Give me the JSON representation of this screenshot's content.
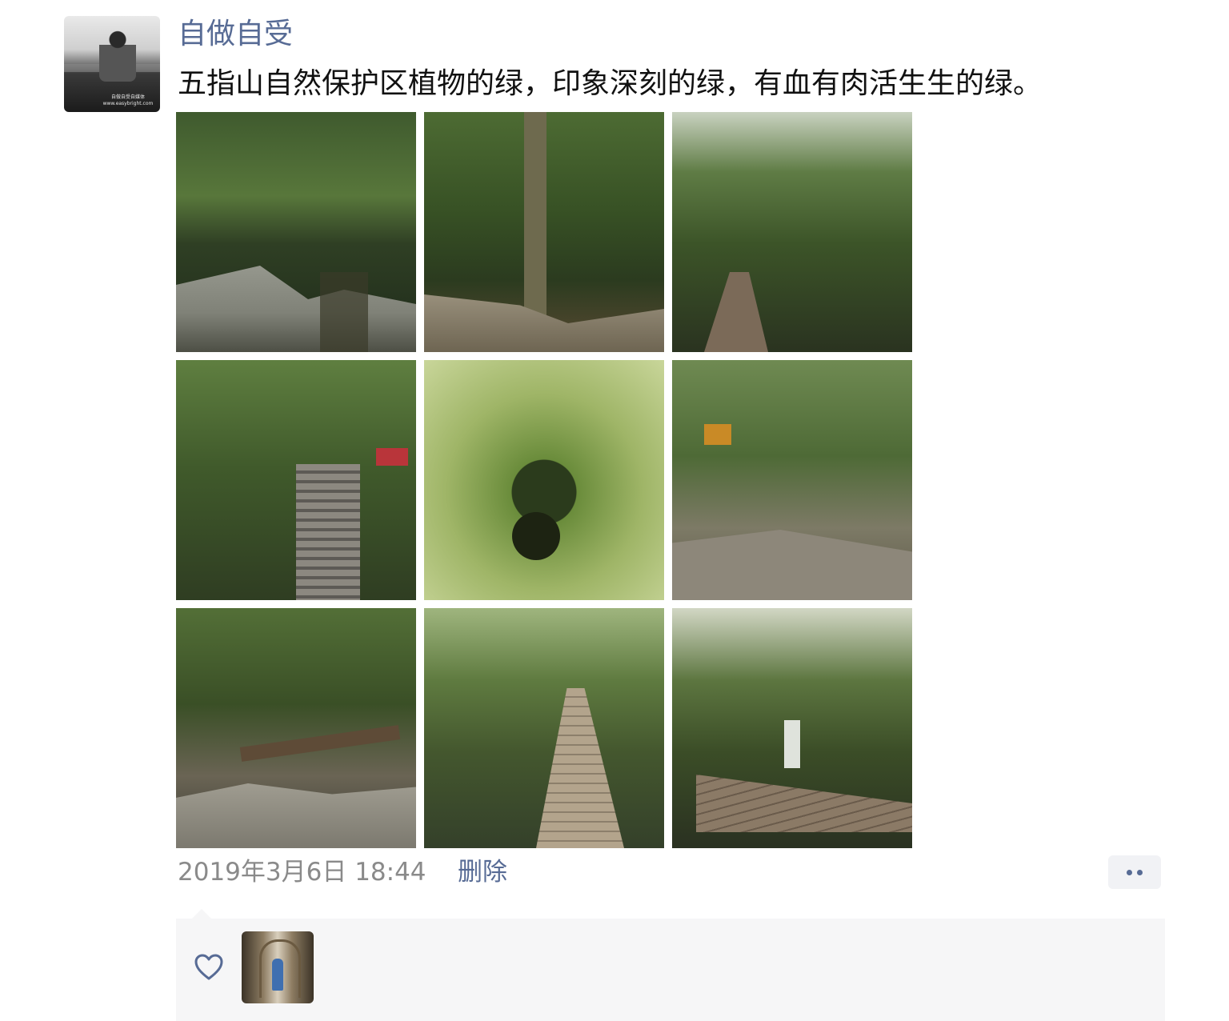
{
  "post": {
    "author": "自做自受",
    "text": "五指山自然保护区植物的绿，印象深刻的绿，有血有肉活生生的绿。",
    "timestamp": "2019年3月6日 18:44",
    "delete_label": "删除",
    "avatar_caption": "自做自受自媒体 www.easybright.com",
    "photos": [
      {
        "name": "photo-rocky-stream"
      },
      {
        "name": "photo-tree-trunk-vines"
      },
      {
        "name": "photo-wooden-boardwalk-jungle"
      },
      {
        "name": "photo-stone-stairs-railing"
      },
      {
        "name": "photo-birdsnest-fern"
      },
      {
        "name": "photo-forest-trail-sign"
      },
      {
        "name": "photo-fallen-tree-stream"
      },
      {
        "name": "photo-boardwalk-descending"
      },
      {
        "name": "photo-boardwalk-waterfall"
      }
    ]
  },
  "likes": {
    "icon": "heart-icon",
    "likers": [
      {
        "name": "liker-avatar"
      }
    ]
  }
}
